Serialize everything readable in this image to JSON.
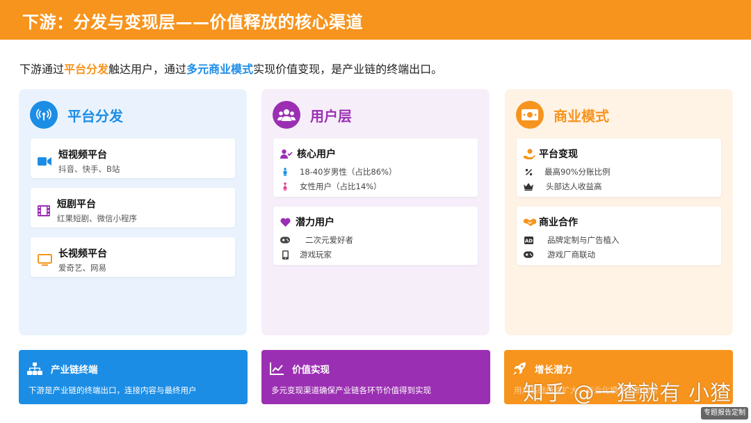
{
  "header": {
    "title": "下游：分发与变现层——价值释放的核心渠道"
  },
  "intro": {
    "p1": "下游通过",
    "hl1": "平台分发",
    "p2": "触达用户，通过",
    "hl2": "多元商业模式",
    "p3": "实现价值变现，是产业链的终端出口。"
  },
  "colors": {
    "orange": "#f7941d",
    "blue": "#1c8de5",
    "purple": "#9b2fb3"
  },
  "columns": [
    {
      "title": "平台分发",
      "icon": "antenna-icon",
      "cards": [
        {
          "title": "短视频平台",
          "sub": "抖音、快手、B站",
          "icon": "video-camera-icon"
        },
        {
          "title": "短剧平台",
          "sub": "红果短剧、微信小程序",
          "icon": "film-icon"
        },
        {
          "title": "长视频平台",
          "sub": "爱奇艺、网易",
          "icon": "tv-icon"
        }
      ]
    },
    {
      "title": "用户层",
      "icon": "users-icon",
      "cards": [
        {
          "title": "核心用户",
          "icon": "user-check-icon",
          "items": [
            {
              "text": "18-40岁男性（占比86%）",
              "icon": "male-icon"
            },
            {
              "text": "女性用户（占比14%）",
              "icon": "female-icon"
            }
          ]
        },
        {
          "title": "潜力用户",
          "icon": "heart-icon",
          "items": [
            {
              "text": "二次元爱好者",
              "icon": "gamepad-icon"
            },
            {
              "text": "游戏玩家",
              "icon": "mobile-icon"
            }
          ]
        }
      ]
    },
    {
      "title": "商业模式",
      "icon": "money-icon",
      "cards": [
        {
          "title": "平台变现",
          "icon": "hand-coin-icon",
          "items": [
            {
              "text": "最高90%分账比例",
              "icon": "percent-icon"
            },
            {
              "text": "头部达人收益高",
              "icon": "crown-icon"
            }
          ]
        },
        {
          "title": "商业合作",
          "icon": "handshake-icon",
          "items": [
            {
              "text": "品牌定制与广告植入",
              "icon": "ad-icon"
            },
            {
              "text": "游戏厂商联动",
              "icon": "gamepad-icon"
            }
          ]
        }
      ]
    }
  ],
  "bottom": [
    {
      "title": "产业链终端",
      "text": "下游是产业链的终端出口，连接内容与最终用户",
      "icon": "sitemap-icon"
    },
    {
      "title": "价值实现",
      "text": "多元变现渠道确保产业链各环节价值得到实现",
      "icon": "chart-line-icon"
    },
    {
      "title": "增长潜力",
      "text": "用户基础持续扩大，商业化模式不断创新",
      "icon": "rocket-icon"
    }
  ],
  "watermark": "知乎 @一猹就有 小猹",
  "tag": "专题报告定制"
}
